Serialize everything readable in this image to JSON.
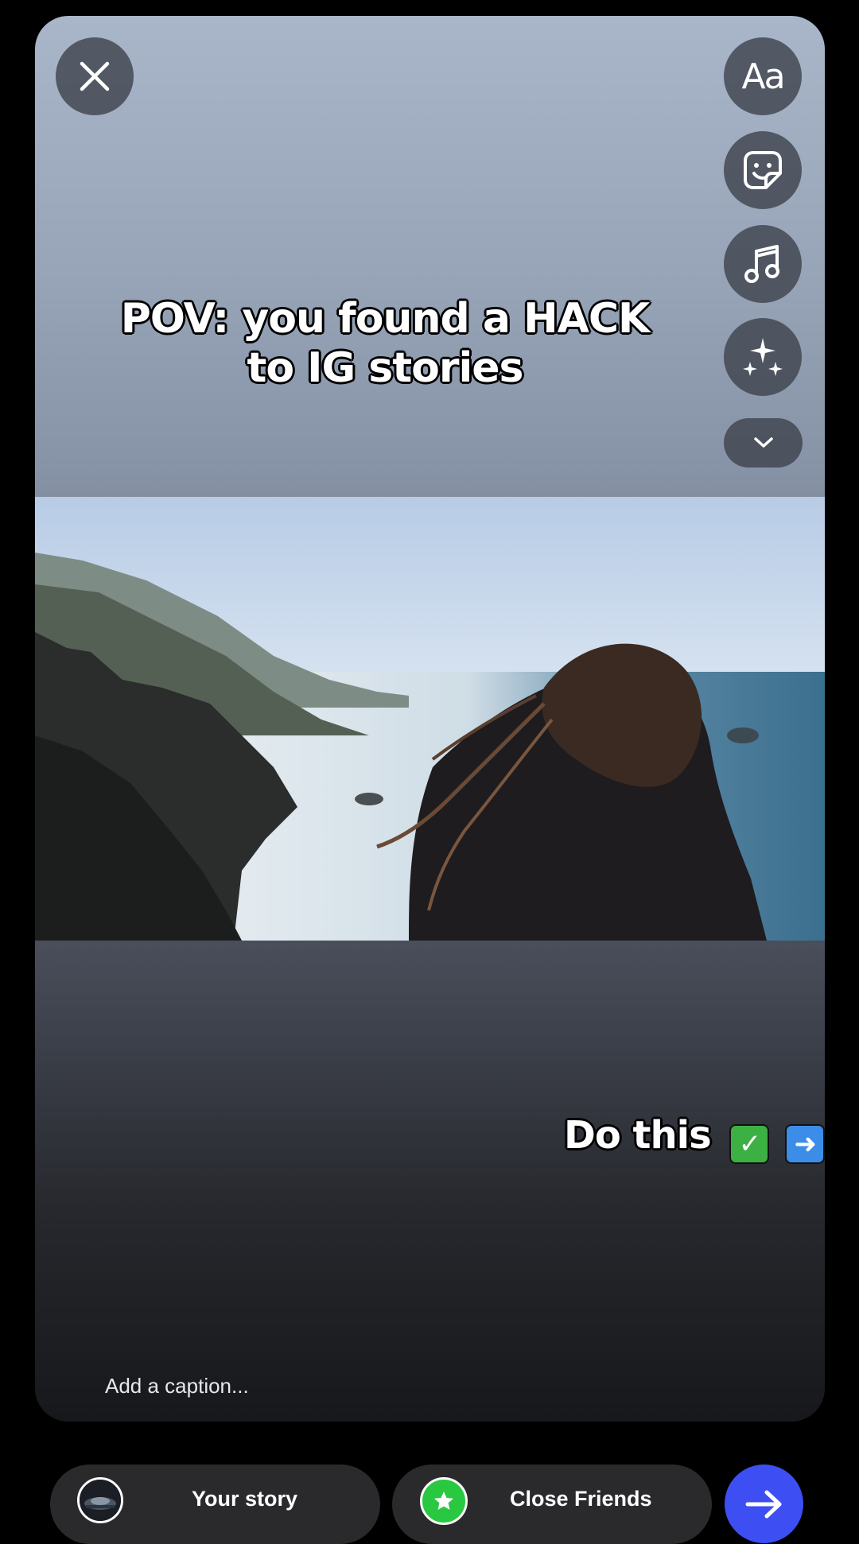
{
  "editor": {
    "overlay_text_top": "POV: you found a HACK to IG stories",
    "overlay_text_bottom": "Do this",
    "caption_placeholder": "Add a caption...",
    "tools": {
      "text_label": "Aa",
      "icons": [
        "close-icon",
        "text-icon",
        "sticker-icon",
        "music-icon",
        "effects-icon",
        "chevron-down-icon"
      ]
    }
  },
  "share_bar": {
    "your_story_label": "Your story",
    "close_friends_label": "Close Friends",
    "next_icon": "arrow-right-icon"
  },
  "colors": {
    "close_friends": "#28c840",
    "next_button": "#3d4ff2",
    "check_emoji": "#3cb043",
    "arrow_emoji": "#3b8de8"
  }
}
